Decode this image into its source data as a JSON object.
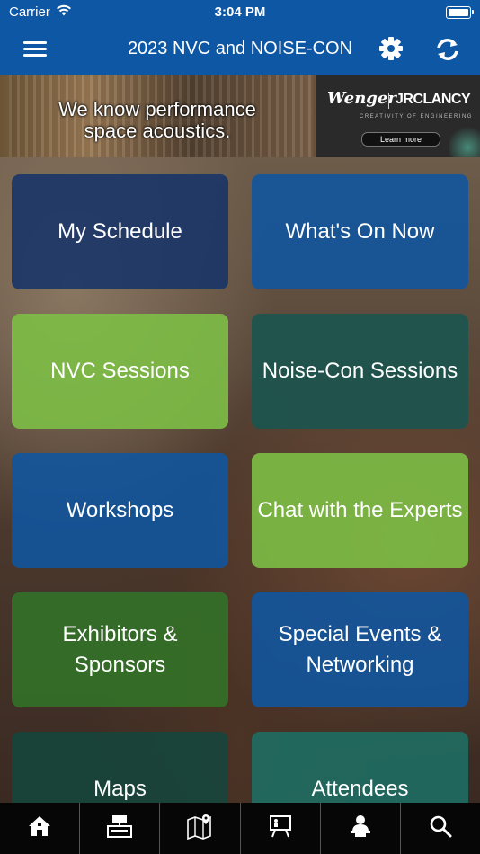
{
  "status_bar": {
    "carrier": "Carrier",
    "time": "3:04 PM",
    "icons": [
      "wifi-icon",
      "battery-icon"
    ]
  },
  "nav_bar": {
    "title": "2023 NVC and NOISE-CON",
    "icons": [
      "menu-icon",
      "gear-icon",
      "refresh-icon"
    ],
    "color": "#0d57a4"
  },
  "banner": {
    "headline_line1": "We know performance",
    "headline_line2": "space acoustics.",
    "brand_left": "Wenger",
    "brand_right": "JRCLANCY",
    "tagline": "CREATIVITY OF ENGINEERING",
    "cta": "Learn more"
  },
  "tiles": [
    {
      "label": "My Schedule",
      "color": "navy"
    },
    {
      "label": "What's On Now",
      "color": "blue"
    },
    {
      "label": "NVC Sessions",
      "color": "lightgreen"
    },
    {
      "label": "Noise-Con Sessions",
      "color": "teal"
    },
    {
      "label": "Workshops",
      "color": "blue"
    },
    {
      "label": "Chat with the Experts",
      "color": "lightgreen"
    },
    {
      "label": "Exhibitors & Sponsors",
      "color": "darkgreen"
    },
    {
      "label": "Special Events & Networking",
      "color": "blue"
    },
    {
      "label": "Maps",
      "color": "darkteal"
    },
    {
      "label": "Attendees",
      "color": "midteal"
    }
  ],
  "tab_bar": {
    "icons": [
      "home-icon",
      "exhibitor-booth-icon",
      "map-icon",
      "presentation-icon",
      "speaker-icon",
      "search-icon"
    ]
  }
}
